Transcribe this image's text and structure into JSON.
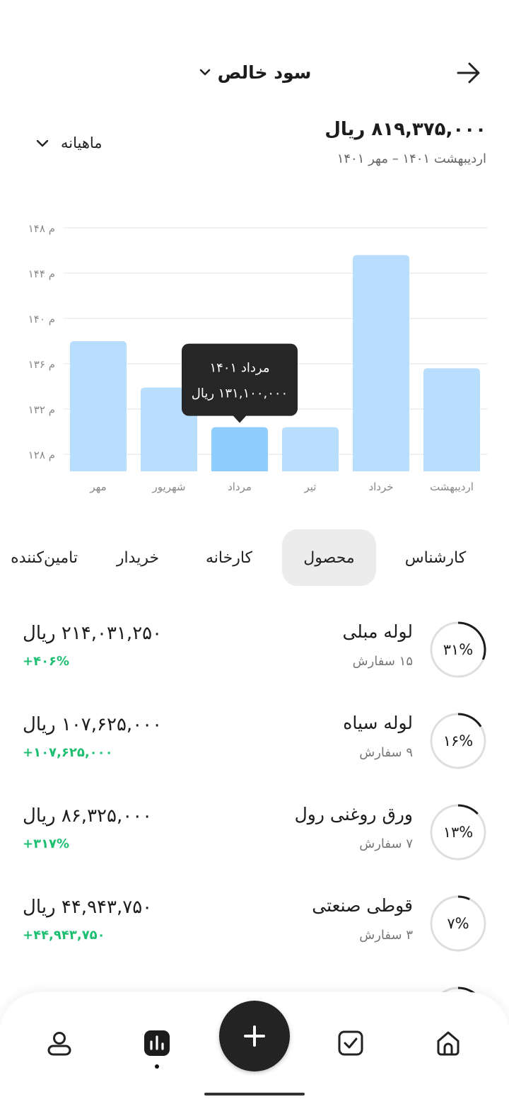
{
  "header": {
    "title": "سود خالص",
    "back_icon": "arrow-right-icon",
    "title_dropdown_icon": "chevron-down-icon"
  },
  "summary": {
    "total": "۸۱۹,۳۷۵,۰۰۰ ریال",
    "date_range": "اردیبهشت ۱۴۰۱ – مهر ۱۴۰۱",
    "period": "ماهیانه"
  },
  "chart_data": {
    "type": "bar",
    "categories": [
      "اردیبهشت",
      "خرداد",
      "تیر",
      "مرداد",
      "شهریور",
      "مهر"
    ],
    "values": [
      135.6,
      145.6,
      130.4,
      130.4,
      133.9,
      138.0
    ],
    "ylim": [
      126.5,
      148
    ],
    "yticks": [
      128,
      132,
      136,
      140,
      144,
      148
    ],
    "ytick_labels": [
      "۱۲۸ م",
      "۱۳۲ م",
      "۱۳۶ م",
      "۱۴۰ م",
      "۱۴۴ م",
      "۱۴۸ م"
    ],
    "highlight_index": 3,
    "grid": true,
    "colors": {
      "bar": "#b9defd",
      "bar_active": "#8ecdfd",
      "grid": "#e6e6e6"
    },
    "tooltip": {
      "line1": "مرداد ۱۴۰۱",
      "line2": "۱۳۱,۱۰۰,۰۰۰ ریال"
    }
  },
  "tabs": [
    {
      "label": "کارشناس",
      "active": false
    },
    {
      "label": "محصول",
      "active": true
    },
    {
      "label": "کارخانه",
      "active": false
    },
    {
      "label": "خریدار",
      "active": false
    },
    {
      "label": "تامین‌کننده",
      "active": false
    }
  ],
  "products": [
    {
      "name": "لوله مبلی",
      "orders": "۱۵ سفارش",
      "amount": "۲۱۴,۰۳۱,۲۵۰ ریال",
      "change": "+۴۰۶%",
      "percent_label": "۳۱%",
      "percent": 31
    },
    {
      "name": "لوله سیاه",
      "orders": "۹ سفارش",
      "amount": "۱۰۷,۶۲۵,۰۰۰ ریال",
      "change": "+۱۰۷,۶۲۵,۰۰۰",
      "percent_label": "۱۶%",
      "percent": 16
    },
    {
      "name": "ورق روغنی رول",
      "orders": "۷ سفارش",
      "amount": "۸۶,۳۲۵,۰۰۰ ریال",
      "change": "+۳۱۷%",
      "percent_label": "۱۳%",
      "percent": 13
    },
    {
      "name": "قوطی صنعتی",
      "orders": "۳ سفارش",
      "amount": "۴۴,۹۴۳,۷۵۰ ریال",
      "change": "+۴۴,۹۴۳,۷۵۰",
      "percent_label": "۷%",
      "percent": 7
    }
  ],
  "colors": {
    "accent_positive": "#1fbf72",
    "fab": "#232323",
    "ring_track": "#dedede",
    "ring_fill": "#1c1c1c"
  },
  "bottom_nav": {
    "items": [
      "home-icon",
      "checkbox-icon",
      "plus-icon",
      "chart-icon",
      "profile-icon"
    ],
    "active": "chart-icon"
  }
}
